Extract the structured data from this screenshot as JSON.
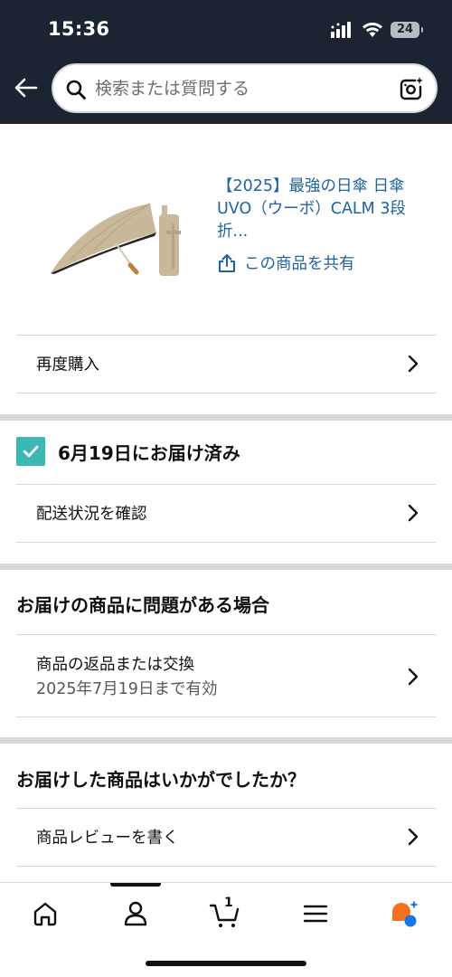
{
  "status_bar": {
    "time": "15:36",
    "battery": "24"
  },
  "search": {
    "placeholder": "検索または質問する"
  },
  "product": {
    "title": "【2025】最強の日傘 日傘 UVO（ウーボ）CALM 3段折...",
    "share_label": "この商品を共有"
  },
  "rows": {
    "rebuy": "再度購入",
    "track": "配送状況を確認",
    "review": "商品レビューを書く"
  },
  "delivery": {
    "status": "6月19日にお届け済み"
  },
  "problem_section": {
    "title": "お届けの商品に問題がある場合",
    "return_title": "商品の返品または交換",
    "return_sub": "2025年7月19日まで有効"
  },
  "feedback_section": {
    "title": "お届けした商品はいかがでしたか？"
  },
  "tabbar": {
    "items": [
      "home-icon",
      "account-icon",
      "cart-icon",
      "menu-icon",
      "rufus-icon"
    ],
    "cart_count": "1"
  },
  "colors": {
    "header_bg": "#1b2430",
    "link": "#2162a1",
    "check": "#3bb8b3",
    "rufus_orange": "#f37021",
    "rufus_blue": "#1a74e8"
  }
}
